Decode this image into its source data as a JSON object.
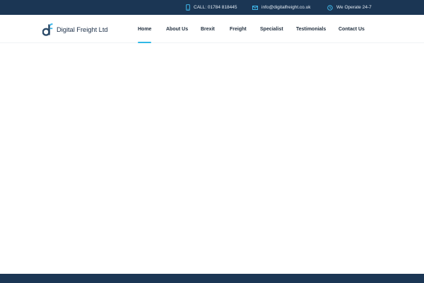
{
  "topbar": {
    "phone": {
      "text": "CALL: 01784 818445",
      "icon": "phone-icon"
    },
    "email": {
      "text": "info@digitalfreight.co.uk",
      "icon": "mail-icon"
    },
    "hours": {
      "text": "We Operate 24-7",
      "icon": "clock-icon"
    },
    "icon_color": "#3fb6e8",
    "background": "#1b3654"
  },
  "header": {
    "logo_text": "Digital Freight Ltd",
    "nav": [
      {
        "label": "Home",
        "active": true
      },
      {
        "label": "About Us"
      },
      {
        "label": "Brexit"
      },
      {
        "label": "Freight"
      },
      {
        "label": "Specialist"
      },
      {
        "label": "Testimonials"
      },
      {
        "label": "Contact Us"
      }
    ],
    "accent": "#2fb8e6"
  }
}
